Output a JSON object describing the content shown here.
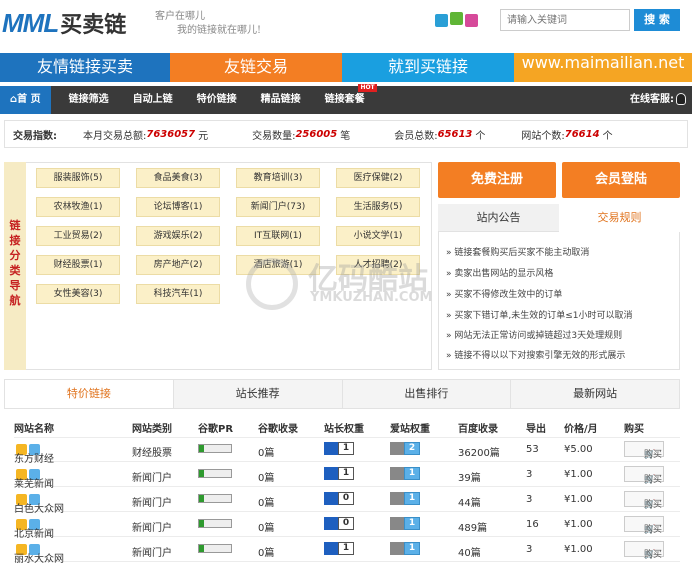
{
  "header": {
    "logo_mark": "MML",
    "logo_text": "买卖链",
    "slogan_line1": "客户在哪儿",
    "slogan_line2": "我的链接就在哪儿!",
    "search_placeholder": "请输入关键词",
    "search_button": "搜 索"
  },
  "banner": [
    {
      "label": "友情链接买卖",
      "color": "#1e73be"
    },
    {
      "label": "友链交易",
      "color": "#f37e23"
    },
    {
      "label": "就到买链接",
      "color": "#1a9fe0"
    },
    {
      "label": "www.maimailian.net",
      "color": "#f5a523"
    }
  ],
  "nav": {
    "items": [
      "首 页",
      "链接筛选",
      "自动上链",
      "特价链接",
      "精品链接",
      "链接套餐"
    ],
    "hot": "HOT",
    "online": "在线客服:"
  },
  "stats": {
    "label": "交易指数:",
    "total_label": "本月交易总额:",
    "total_value": "7636057",
    "total_unit": "元",
    "count_label": "交易数量:",
    "count_value": "256005",
    "count_unit": "笔",
    "members_label": "会员总数:",
    "members_value": "65613",
    "members_unit": "个",
    "sites_label": "网站个数:",
    "sites_value": "76614",
    "sites_unit": "个"
  },
  "categories": {
    "title": "链接分类导航",
    "items": [
      "服装服饰(5)",
      "食品美食(3)",
      "教育培训(3)",
      "医疗保健(2)",
      "农林牧渔(1)",
      "论坛博客(1)",
      "新闻门户(73)",
      "生活服务(5)",
      "工业贸易(2)",
      "游戏娱乐(2)",
      "IT互联网(1)",
      "小说文学(1)",
      "财经股票(1)",
      "房产地产(2)",
      "酒店旅游(1)",
      "人才招聘(2)",
      "女性美容(3)",
      "科技汽车(1)"
    ]
  },
  "buttons": {
    "register": "免费注册",
    "login": "会员登陆"
  },
  "notice": {
    "tab1": "站内公告",
    "tab2": "交易规则",
    "items": [
      "链接套餐购买后买家不能主动取消",
      "卖家出售网站的显示风格",
      "买家不得修改生效中的订单",
      "买家下错订单,未生效的订单≤1小时可以取消",
      "网站无法正常访问或掉链超过3天处理规则",
      "链接不得以以下对搜索引擎无效的形式展示"
    ]
  },
  "watermark": {
    "cn": "亿码酷站",
    "en": "YMKUZHAN.COM"
  },
  "tabs": [
    "特价链接",
    "站长推荐",
    "出售排行",
    "最新网站"
  ],
  "table": {
    "headers": [
      "网站名称",
      "网站类别",
      "谷歌PR",
      "谷歌收录",
      "站长权重",
      "爱站权重",
      "百度收录",
      "导出",
      "价格/月",
      "购买"
    ],
    "rows": [
      {
        "name": "东方财经",
        "cat": "财经股票",
        "pr": "0",
        "gsl": "0篇",
        "zz": "1",
        "az": "2",
        "bd": "36200篇",
        "out": "53",
        "price": "¥5.00",
        "buy": "购买"
      },
      {
        "name": "莱芜新闻",
        "cat": "新闻门户",
        "pr": "0",
        "gsl": "0篇",
        "zz": "1",
        "az": "1",
        "bd": "39篇",
        "out": "3",
        "price": "¥1.00",
        "buy": "购买"
      },
      {
        "name": "白色大众网",
        "cat": "新闻门户",
        "pr": "0",
        "gsl": "0篇",
        "zz": "0",
        "az": "1",
        "bd": "44篇",
        "out": "3",
        "price": "¥1.00",
        "buy": "购买"
      },
      {
        "name": "北京新闻",
        "cat": "新闻门户",
        "pr": "0",
        "gsl": "0篇",
        "zz": "0",
        "az": "1",
        "bd": "489篇",
        "out": "16",
        "price": "¥1.00",
        "buy": "购买"
      },
      {
        "name": "丽水大众网",
        "cat": "新闻门户",
        "pr": "0",
        "gsl": "0篇",
        "zz": "1",
        "az": "1",
        "bd": "40篇",
        "out": "3",
        "price": "¥1.00",
        "buy": "购买"
      }
    ]
  }
}
